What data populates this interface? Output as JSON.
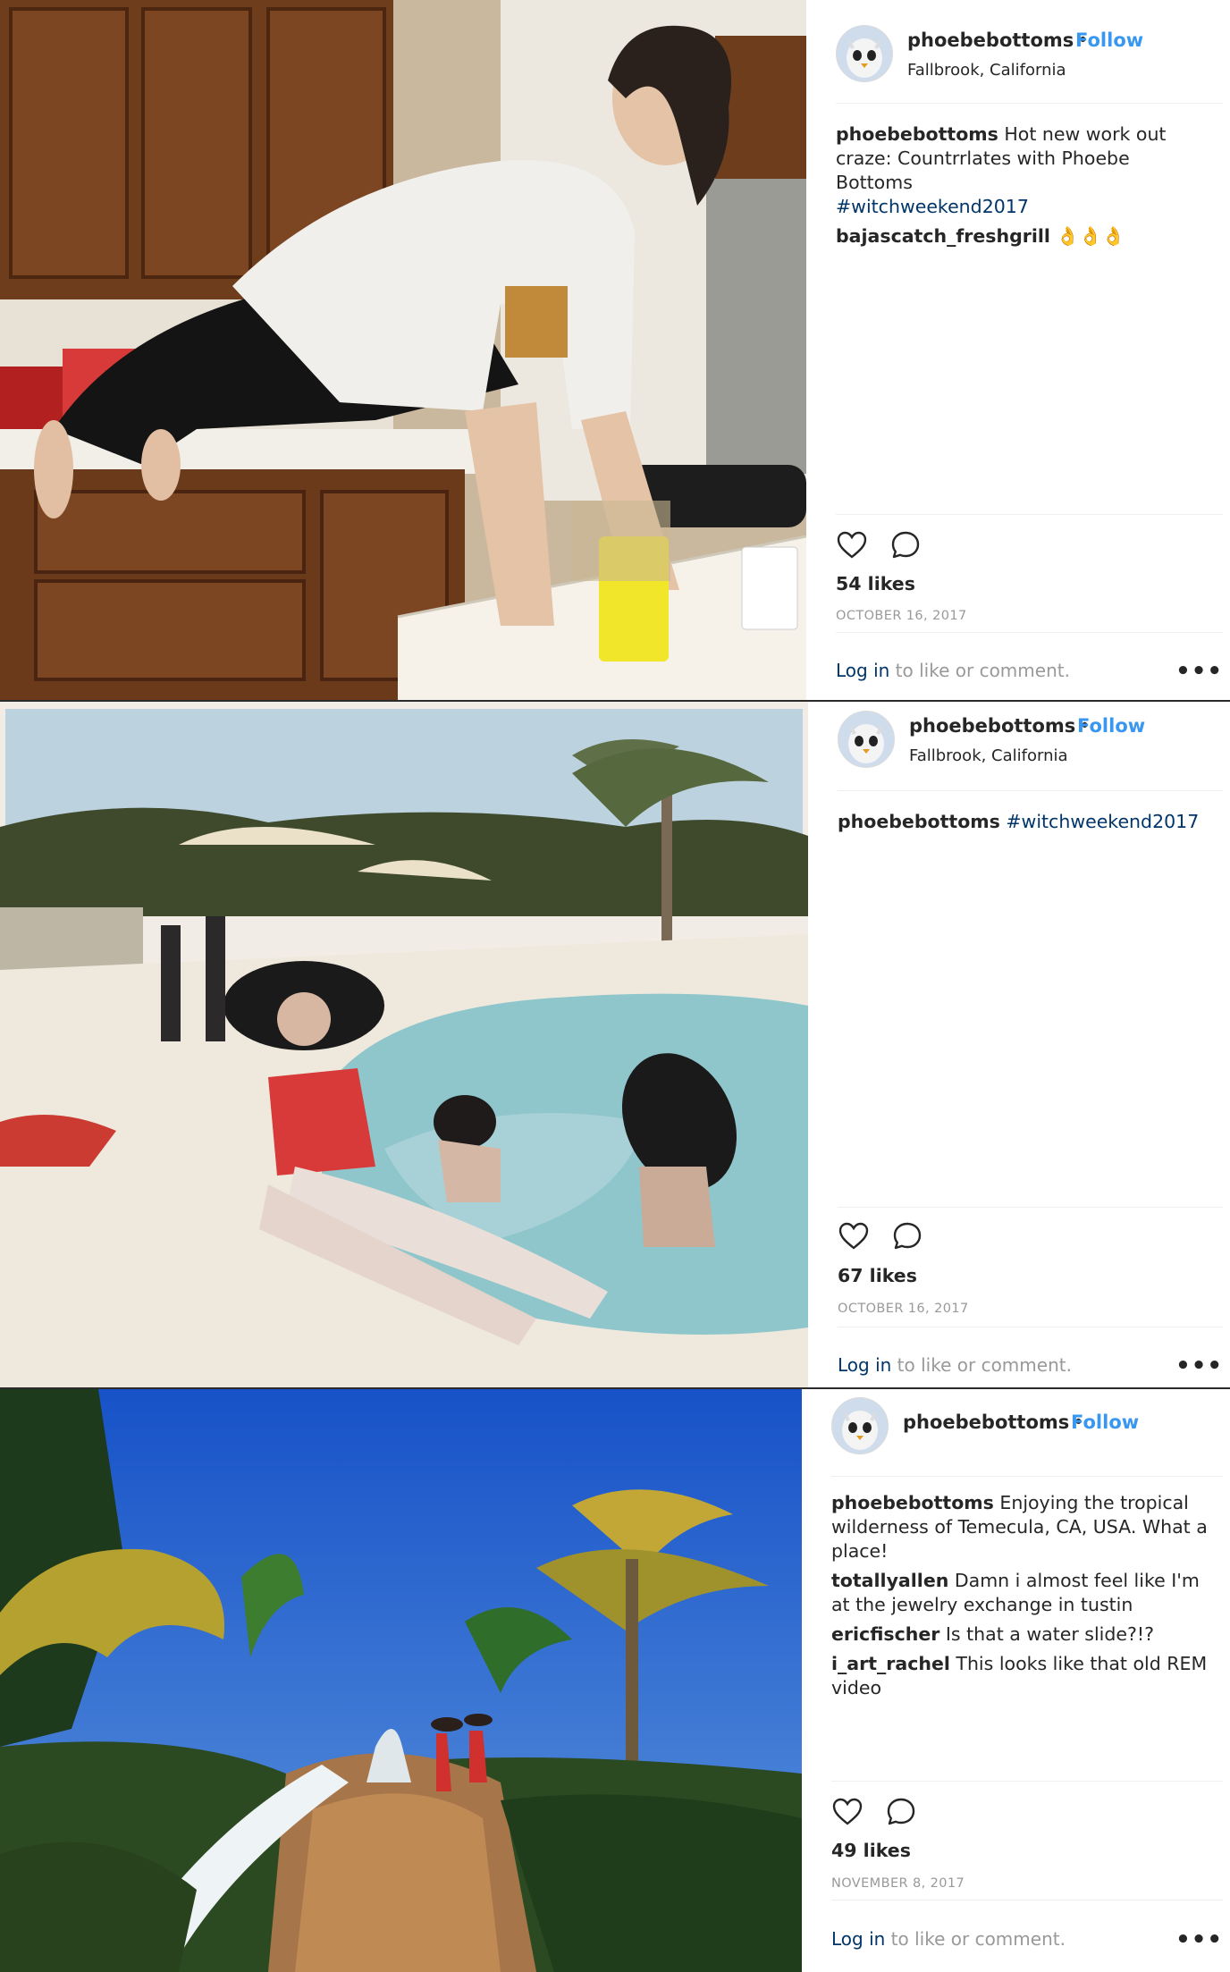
{
  "posts": [
    {
      "username": "phoebebottoms",
      "dot": "•",
      "follow": "Follow",
      "location": "Fallbrook, California",
      "caption_user": "phoebebottoms",
      "caption_text": "Hot new work out craze: Countrrlates with Phoebe Bottoms",
      "caption_tag": "#witchweekend2017",
      "comments": [
        {
          "user": "bajascatch_freshgrill",
          "text": "👌👌👌"
        }
      ],
      "likes": "54 likes",
      "date": "OCTOBER 16, 2017",
      "login_link": "Log in",
      "login_text": " to like or comment.",
      "more": "•••",
      "icons": [
        "heart-icon",
        "comment-icon"
      ]
    },
    {
      "username": "phoebebottoms",
      "dot": "•",
      "follow": "Follow",
      "location": "Fallbrook, California",
      "caption_user": "phoebebottoms",
      "caption_tag": "#witchweekend2017",
      "likes": "67 likes",
      "date": "OCTOBER 16, 2017",
      "login_link": "Log in",
      "login_text": " to like or comment.",
      "more": "•••",
      "icons": [
        "heart-icon",
        "comment-icon"
      ]
    },
    {
      "username": "phoebebottoms",
      "dot": "•",
      "follow": "Follow",
      "caption_user": "phoebebottoms",
      "caption_text": "Enjoying the tropical wilderness of Temecula, CA, USA. What a place!",
      "comments": [
        {
          "user": "totallyallen",
          "text": "Damn i almost feel like I'm at the jewelry exchange in tustin"
        },
        {
          "user": "ericfischer",
          "text": "Is that a water slide?!?"
        },
        {
          "user": "i_art_rachel",
          "text": "This looks like that old REM video"
        }
      ],
      "likes": "49 likes",
      "date": "NOVEMBER 8, 2017",
      "login_link": "Log in",
      "login_text": " to like or comment.",
      "more": "•••",
      "icons": [
        "heart-icon",
        "comment-icon"
      ]
    }
  ]
}
